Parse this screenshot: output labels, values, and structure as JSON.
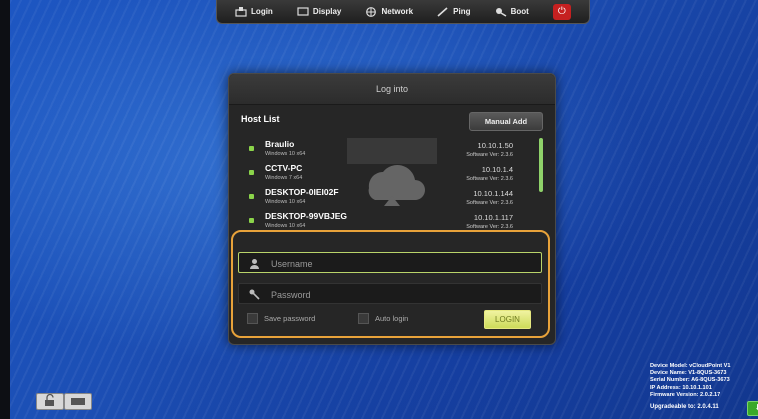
{
  "toolbar": {
    "items": [
      {
        "label": "Login",
        "icon": "login-icon"
      },
      {
        "label": "Display",
        "icon": "display-icon"
      },
      {
        "label": "Network",
        "icon": "network-icon"
      },
      {
        "label": "Ping",
        "icon": "ping-icon"
      },
      {
        "label": "Boot",
        "icon": "boot-icon"
      }
    ],
    "power_icon": "power-icon"
  },
  "dialog": {
    "title": "Log into",
    "host_list_label": "Host List",
    "manual_add_label": "Manual Add",
    "hosts": [
      {
        "name": "Braulio",
        "os": "Windows 10 x64",
        "ip": "10.10.1.50",
        "version": "Software Ver: 2.3.6"
      },
      {
        "name": "CCTV-PC",
        "os": "Windows 7 x64",
        "ip": "10.10.1.4",
        "version": "Software Ver: 2.3.6"
      },
      {
        "name": "DESKTOP-0IEI02F",
        "os": "Windows 10 x64",
        "ip": "10.10.1.144",
        "version": "Software Ver: 2.3.6"
      },
      {
        "name": "DESKTOP-99VBJEG",
        "os": "Windows 10 x64",
        "ip": "10.10.1.117",
        "version": "Software Ver: 2.3.6"
      }
    ],
    "username_placeholder": "Username",
    "password_placeholder": "Password",
    "save_password_label": "Save password",
    "auto_login_label": "Auto login",
    "login_label": "LOGIN"
  },
  "device_info": {
    "lines": [
      "Device Model: vCloudPoint V1",
      "Device Name: V1-8QUS-3673",
      "Serial Number: A6-8QUS-3673",
      "IP Address: 10.10.1.101",
      "Firmware Version: 2.0.2.17"
    ],
    "upgrade_text": "Upgradeable to: 2.0.4.11"
  },
  "colors": {
    "accent_green": "#8bd44a",
    "highlight_orange": "#e8a23a",
    "power_red": "#c62020"
  }
}
